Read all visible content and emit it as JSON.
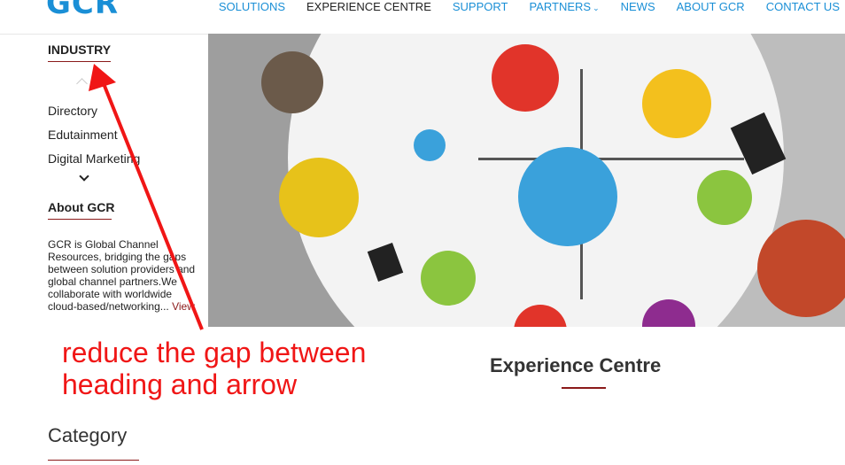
{
  "brand": {
    "logo_text": "GCR"
  },
  "nav": {
    "items": [
      "SOLUTIONS",
      "EXPERIENCE CENTRE",
      "SUPPORT",
      "PARTNERS",
      "NEWS",
      "ABOUT GCR",
      "CONTACT US"
    ],
    "partners_chevron": "⌄"
  },
  "sidebar": {
    "industry_heading": "INDUSTRY",
    "industries": [
      "Directory",
      "Edutainment",
      "Digital Marketing"
    ],
    "about_heading": "About GCR",
    "about_text": "GCR is Global Channel Resources, bridging the gaps between solution providers and global channel partners.We collaborate with worldwide cloud-based/networking...",
    "view_link": "View"
  },
  "annotation": {
    "line1": "reduce the gap between",
    "line2": "heading and arrow",
    "color": "#f01616"
  },
  "sections": {
    "experience_title": "Experience Centre",
    "category_title": "Category"
  },
  "colors": {
    "accent": "#1a8fd6",
    "underline": "#8b1a1a"
  }
}
